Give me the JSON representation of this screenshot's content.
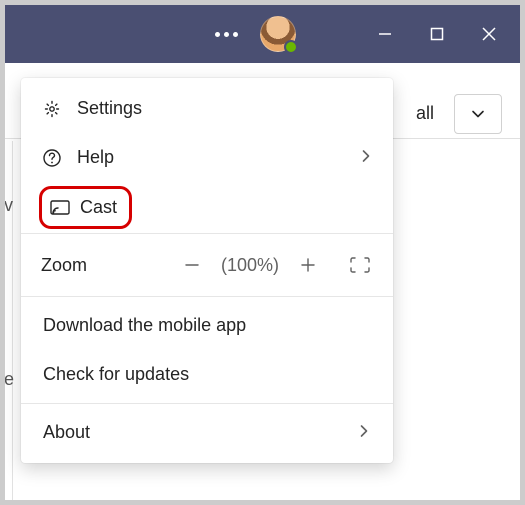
{
  "window": {
    "presence": "available"
  },
  "background": {
    "call_label": "all",
    "peek1": "v",
    "peek2": "e"
  },
  "menu": {
    "settings": "Settings",
    "help": "Help",
    "cast": "Cast",
    "zoom_label": "Zoom",
    "zoom_value": "(100%)",
    "download": "Download the mobile app",
    "updates": "Check for updates",
    "about": "About"
  }
}
